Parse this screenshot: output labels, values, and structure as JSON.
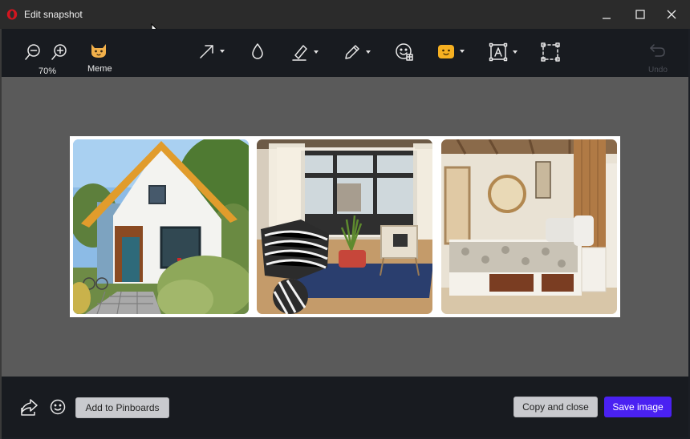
{
  "window": {
    "title": "Edit snapshot",
    "controls": [
      "minimize-icon",
      "maximize-icon",
      "close-icon"
    ]
  },
  "toolbar": {
    "zoom_level": "70%",
    "meme_label": "Meme",
    "undo_label": "Undo",
    "tools": [
      "zoom-out-icon",
      "zoom-in-icon",
      "meme-cat-icon",
      "arrow-tool-icon",
      "blur-drop-icon",
      "highlighter-icon",
      "pencil-icon",
      "sticker-emoji-icon",
      "face-sticker-icon",
      "text-tool-icon",
      "crop-select-icon",
      "undo-icon"
    ]
  },
  "snapshot": {
    "images": [
      "house-exterior-photo",
      "living-room-photo",
      "bedroom-photo"
    ]
  },
  "bottom": {
    "add_to_pinboards": "Add to Pinboards",
    "copy_and_close": "Copy and close",
    "save_image": "Save image"
  },
  "colors": {
    "accent": "#4a21f2",
    "logo": "#d3151f",
    "toolbar_bg": "#181b20",
    "canvas_bg": "#5a5a5a"
  }
}
